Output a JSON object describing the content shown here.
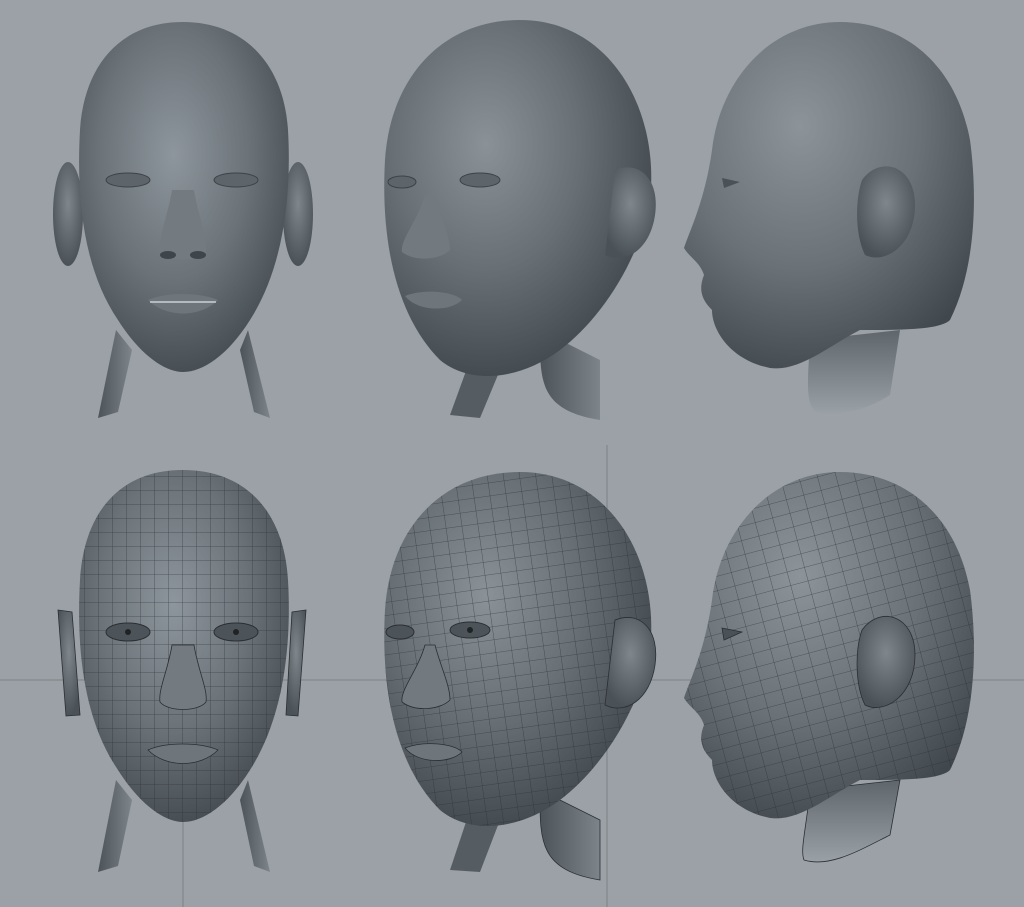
{
  "scene": {
    "background": "#9ba1a6",
    "axis_color": "#7c8186",
    "wire_color": "#2b2f33",
    "shading": {
      "light": "#8e969d",
      "mid": "#6b7379",
      "dark": "#434a50",
      "rim": "#2a2f33"
    }
  },
  "panels": [
    {
      "id": "front-smooth",
      "view": "front",
      "style": "shaded"
    },
    {
      "id": "three-quarter-smooth",
      "view": "three-quarter",
      "style": "shaded"
    },
    {
      "id": "side-smooth",
      "view": "side",
      "style": "shaded"
    },
    {
      "id": "front-wire",
      "view": "front",
      "style": "wireframe"
    },
    {
      "id": "three-quarter-wire",
      "view": "three-quarter",
      "style": "wireframe"
    },
    {
      "id": "side-wire",
      "view": "side",
      "style": "wireframe"
    }
  ]
}
